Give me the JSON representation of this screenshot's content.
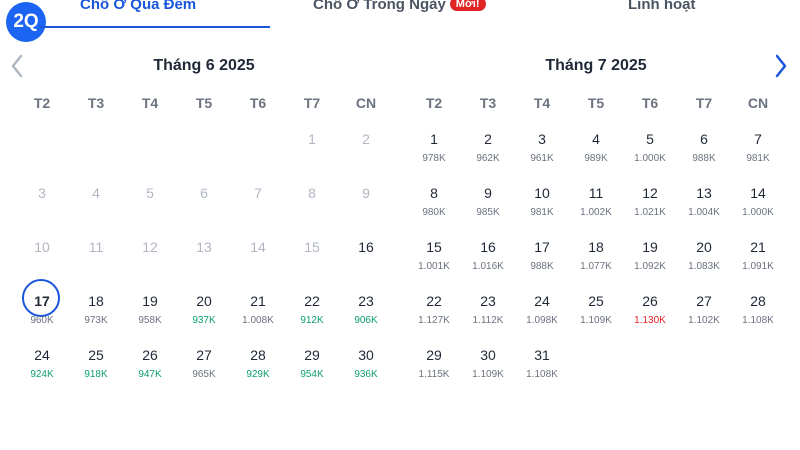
{
  "logo": {
    "text": "2Q"
  },
  "tabs": [
    {
      "label": "Chỗ Ở Qua Đêm",
      "active": true
    },
    {
      "label": "Chỗ Ở Trong Ngày",
      "badge": "Mới!"
    },
    {
      "label": "Linh hoạt"
    }
  ],
  "weekdays": [
    "T2",
    "T3",
    "T4",
    "T5",
    "T6",
    "T7",
    "CN"
  ],
  "icons": {
    "prev": "chevron-left-icon",
    "next": "chevron-right-icon"
  },
  "colors": {
    "accent": "#1a56db",
    "low_price": "#0e9f6e",
    "high_price": "#e02424",
    "disabled": "#b0b7c3"
  },
  "months": [
    {
      "title": "Tháng 6 2025",
      "first_weekday": 6,
      "days": [
        {
          "d": "1",
          "past": true
        },
        {
          "d": "2",
          "past": true
        },
        {
          "d": "3",
          "past": true
        },
        {
          "d": "4",
          "past": true
        },
        {
          "d": "5",
          "past": true
        },
        {
          "d": "6",
          "past": true
        },
        {
          "d": "7",
          "past": true
        },
        {
          "d": "8",
          "past": true
        },
        {
          "d": "9",
          "past": true
        },
        {
          "d": "10",
          "past": true
        },
        {
          "d": "11",
          "past": true
        },
        {
          "d": "12",
          "past": true
        },
        {
          "d": "13",
          "past": true
        },
        {
          "d": "14",
          "past": true
        },
        {
          "d": "15",
          "past": true
        },
        {
          "d": "16"
        },
        {
          "d": "17",
          "price": "960K",
          "selected": true
        },
        {
          "d": "18",
          "price": "973K"
        },
        {
          "d": "19",
          "price": "958K"
        },
        {
          "d": "20",
          "price": "937K",
          "tone": "low"
        },
        {
          "d": "21",
          "price": "1.008K"
        },
        {
          "d": "22",
          "price": "912K",
          "tone": "low"
        },
        {
          "d": "23",
          "price": "906K",
          "tone": "low"
        },
        {
          "d": "24",
          "price": "924K",
          "tone": "low"
        },
        {
          "d": "25",
          "price": "918K",
          "tone": "low"
        },
        {
          "d": "26",
          "price": "947K",
          "tone": "low"
        },
        {
          "d": "27",
          "price": "965K"
        },
        {
          "d": "28",
          "price": "929K",
          "tone": "low"
        },
        {
          "d": "29",
          "price": "954K",
          "tone": "low"
        },
        {
          "d": "30",
          "price": "936K",
          "tone": "low"
        }
      ]
    },
    {
      "title": "Tháng 7 2025",
      "first_weekday": 1,
      "days": [
        {
          "d": "1",
          "price": "978K"
        },
        {
          "d": "2",
          "price": "962K"
        },
        {
          "d": "3",
          "price": "961K"
        },
        {
          "d": "4",
          "price": "989K"
        },
        {
          "d": "5",
          "price": "1.000K"
        },
        {
          "d": "6",
          "price": "988K"
        },
        {
          "d": "7",
          "price": "981K"
        },
        {
          "d": "8",
          "price": "980K"
        },
        {
          "d": "9",
          "price": "985K"
        },
        {
          "d": "10",
          "price": "981K"
        },
        {
          "d": "11",
          "price": "1.002K"
        },
        {
          "d": "12",
          "price": "1.021K"
        },
        {
          "d": "13",
          "price": "1.004K"
        },
        {
          "d": "14",
          "price": "1.000K"
        },
        {
          "d": "15",
          "price": "1.001K"
        },
        {
          "d": "16",
          "price": "1.016K"
        },
        {
          "d": "17",
          "price": "988K"
        },
        {
          "d": "18",
          "price": "1.077K"
        },
        {
          "d": "19",
          "price": "1.092K"
        },
        {
          "d": "20",
          "price": "1.083K"
        },
        {
          "d": "21",
          "price": "1.091K"
        },
        {
          "d": "22",
          "price": "1.127K"
        },
        {
          "d": "23",
          "price": "1.112K"
        },
        {
          "d": "24",
          "price": "1.098K"
        },
        {
          "d": "25",
          "price": "1.109K"
        },
        {
          "d": "26",
          "price": "1.130K",
          "tone": "high"
        },
        {
          "d": "27",
          "price": "1.102K"
        },
        {
          "d": "28",
          "price": "1.108K"
        },
        {
          "d": "29",
          "price": "1.115K"
        },
        {
          "d": "30",
          "price": "1.109K"
        },
        {
          "d": "31",
          "price": "1.108K"
        }
      ]
    }
  ]
}
